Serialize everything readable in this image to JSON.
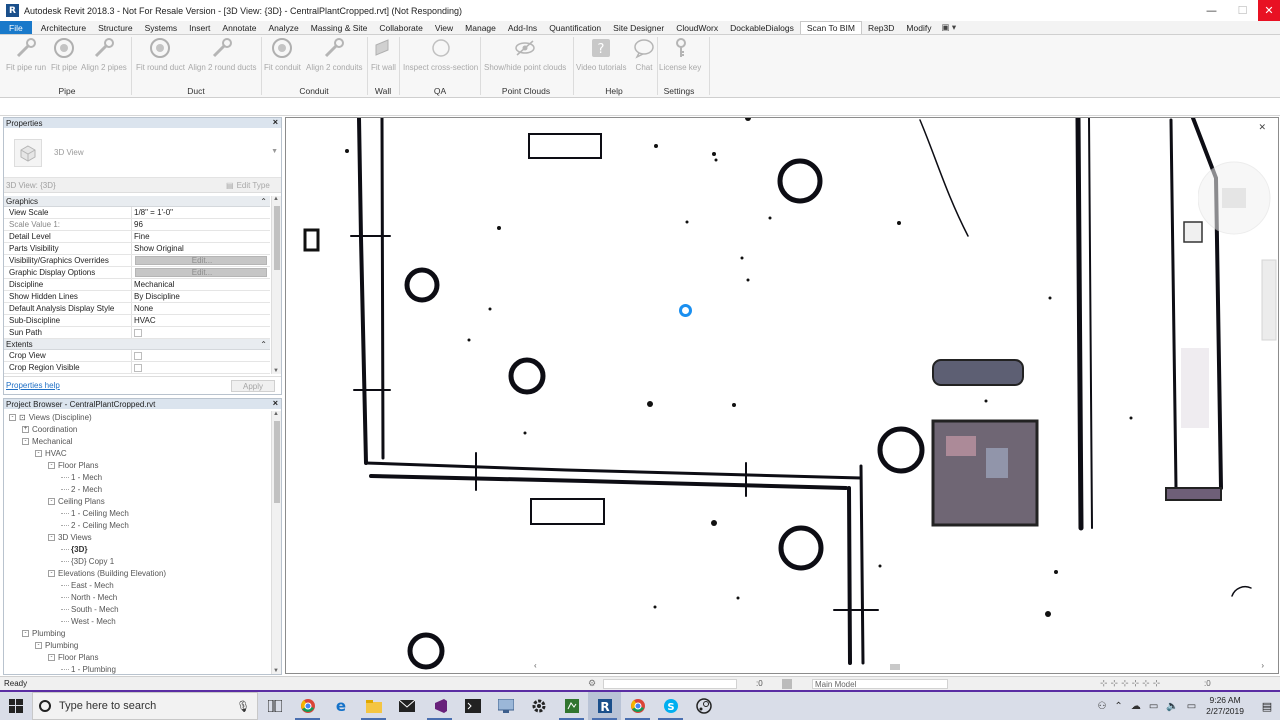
{
  "window": {
    "title": "Autodesk Revit 2018.3 - Not For Resale Version - [3D View: {3D} - CentralPlantCropped.rvt] (Not Responding)",
    "app_icon_letter": "R",
    "minimize": "—",
    "maximize": "☐",
    "close": "✕"
  },
  "ribbon_tabs": [
    {
      "label": "File"
    },
    {
      "label": "Architecture"
    },
    {
      "label": "Structure"
    },
    {
      "label": "Systems"
    },
    {
      "label": "Insert"
    },
    {
      "label": "Annotate"
    },
    {
      "label": "Analyze"
    },
    {
      "label": "Massing & Site"
    },
    {
      "label": "Collaborate"
    },
    {
      "label": "View"
    },
    {
      "label": "Manage"
    },
    {
      "label": "Add-Ins"
    },
    {
      "label": "Quantification"
    },
    {
      "label": "Site Designer"
    },
    {
      "label": "CloudWorx"
    },
    {
      "label": "DockableDialogs"
    },
    {
      "label": "Scan To BIM"
    },
    {
      "label": "Rep3D"
    },
    {
      "label": "Modify"
    }
  ],
  "ribbon_tab_extra": "▣ ▾",
  "ribbon": {
    "buttons": [
      {
        "label": "Fit pipe run",
        "icon": "pipe-wrench-icon"
      },
      {
        "label": "Fit pipe",
        "icon": "pipe-circle-icon"
      },
      {
        "label": "Align 2 pipes",
        "icon": "pipe-wrench-icon"
      },
      {
        "label": "Fit round duct",
        "icon": "duct-circle-icon"
      },
      {
        "label": "Align 2 round ducts",
        "icon": "duct-wrench-icon"
      },
      {
        "label": "Fit conduit",
        "icon": "conduit-circle-icon"
      },
      {
        "label": "Align 2 conduits",
        "icon": "conduit-wrench-icon"
      },
      {
        "label": "Fit wall",
        "icon": "wall-icon"
      },
      {
        "label": "Inspect cross-section",
        "icon": "cross-section-icon"
      },
      {
        "label": "Show/hide point clouds",
        "icon": "eye-slash-icon"
      },
      {
        "label": "Video tutorials",
        "icon": "help-icon"
      },
      {
        "label": "Chat",
        "icon": "chat-icon"
      },
      {
        "label": "License key",
        "icon": "key-icon"
      }
    ],
    "groups": [
      "Pipe",
      "Duct",
      "Conduit",
      "Wall",
      "QA",
      "Point Clouds",
      "Help",
      "Settings"
    ]
  },
  "properties": {
    "title": "Properties",
    "type_name": "3D View",
    "instance_selector": "3D View: {3D}",
    "edit_type": "Edit Type",
    "categories": [
      {
        "name": "Graphics",
        "rows": [
          {
            "key": "View Scale",
            "value": "1/8\" = 1'-0\""
          },
          {
            "key": "Scale Value    1:",
            "value": "96"
          },
          {
            "key": "Detail Level",
            "value": "Fine"
          },
          {
            "key": "Parts Visibility",
            "value": "Show Original"
          },
          {
            "key": "Visibility/Graphics Overrides",
            "value": "Edit..."
          },
          {
            "key": "Graphic Display Options",
            "value": "Edit..."
          },
          {
            "key": "Discipline",
            "value": "Mechanical"
          },
          {
            "key": "Show Hidden Lines",
            "value": "By Discipline"
          },
          {
            "key": "Default Analysis Display Style",
            "value": "None"
          },
          {
            "key": "Sub-Discipline",
            "value": "HVAC"
          },
          {
            "key": "Sun Path",
            "value": ""
          }
        ]
      },
      {
        "name": "Extents",
        "rows": [
          {
            "key": "Crop View",
            "value": ""
          },
          {
            "key": "Crop Region Visible",
            "value": ""
          }
        ]
      }
    ],
    "help_link": "Properties help",
    "apply": "Apply"
  },
  "browser": {
    "title": "Project Browser - CentralPlantCropped.rvt",
    "nodes": [
      {
        "label": "Views (Discipline)",
        "level": 0,
        "exp": "-"
      },
      {
        "label": "Coordination",
        "level": 1,
        "exp": "+"
      },
      {
        "label": "Mechanical",
        "level": 1,
        "exp": "-"
      },
      {
        "label": "HVAC",
        "level": 2,
        "exp": "-"
      },
      {
        "label": "Floor Plans",
        "level": 3,
        "exp": "-"
      },
      {
        "label": "1 - Mech",
        "level": 4,
        "exp": ""
      },
      {
        "label": "2 - Mech",
        "level": 4,
        "exp": ""
      },
      {
        "label": "Ceiling Plans",
        "level": 3,
        "exp": "-"
      },
      {
        "label": "1 - Ceiling Mech",
        "level": 4,
        "exp": ""
      },
      {
        "label": "2 - Ceiling Mech",
        "level": 4,
        "exp": ""
      },
      {
        "label": "3D Views",
        "level": 3,
        "exp": "-"
      },
      {
        "label": "{3D}",
        "level": 4,
        "exp": "",
        "bold": true
      },
      {
        "label": "{3D} Copy 1",
        "level": 4,
        "exp": ""
      },
      {
        "label": "Elevations (Building Elevation)",
        "level": 3,
        "exp": "-"
      },
      {
        "label": "East - Mech",
        "level": 4,
        "exp": ""
      },
      {
        "label": "North - Mech",
        "level": 4,
        "exp": ""
      },
      {
        "label": "South - Mech",
        "level": 4,
        "exp": ""
      },
      {
        "label": "West - Mech",
        "level": 4,
        "exp": ""
      },
      {
        "label": "Plumbing",
        "level": 1,
        "exp": "-"
      },
      {
        "label": "Plumbing",
        "level": 2,
        "exp": "-"
      },
      {
        "label": "Floor Plans",
        "level": 3,
        "exp": "-"
      },
      {
        "label": "1 - Plumbing",
        "level": 4,
        "exp": ""
      }
    ]
  },
  "status": {
    "text": "Ready",
    "coord": ":0",
    "model": "Main Model",
    "filter": ":0"
  },
  "taskbar": {
    "search_placeholder": "Type here to search",
    "time": "9:26 AM",
    "date": "2/27/2019",
    "apps": [
      "task-view-icon",
      "chrome-icon",
      "edge-icon",
      "file-explorer-icon",
      "mail-icon",
      "visual-studio-icon",
      "terminal-icon",
      "remote-desktop-icon",
      "settings-icon",
      "project-icon",
      "revit-icon",
      "chrome-icon",
      "skype-icon",
      "steam-icon"
    ]
  },
  "colors": {
    "accent": "#1979ca",
    "panel_header": "#dbe4ee",
    "taskbar_border": "#5a2da3",
    "close_red": "#e81123"
  }
}
